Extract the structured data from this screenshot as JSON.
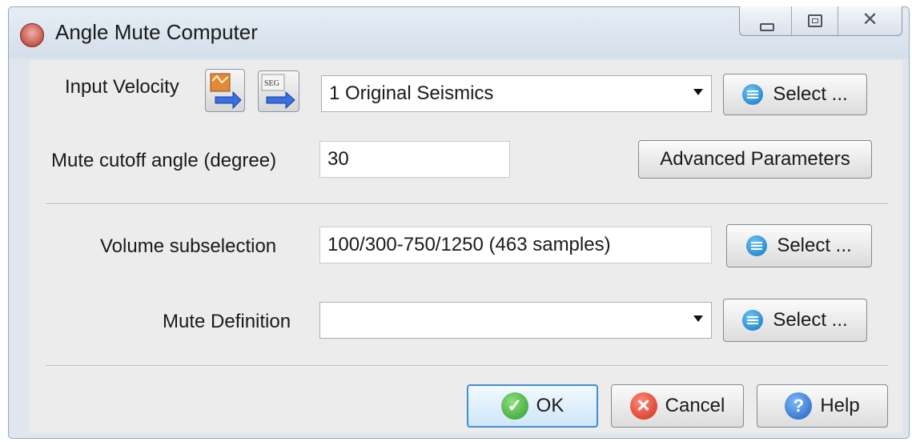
{
  "window": {
    "title": "Angle Mute Computer",
    "controls": {
      "close_glyph": "✕"
    }
  },
  "input_velocity": {
    "label": "Input Velocity",
    "selected": "1 Original Seismics",
    "select_label": "Select ...",
    "seg_icon_text": "SEG"
  },
  "mute_cutoff": {
    "label": "Mute cutoff angle (degree)",
    "value": "30",
    "advanced_label": "Advanced Parameters"
  },
  "volume_subselection": {
    "label": "Volume subselection",
    "value": "100/300-750/1250 (463 samples)",
    "select_label": "Select ..."
  },
  "mute_definition": {
    "label": "Mute Definition",
    "selected": "",
    "select_label": "Select ..."
  },
  "footer": {
    "ok_label": "OK",
    "ok_icon_glyph": "✓",
    "cancel_label": "Cancel",
    "cancel_icon_glyph": "✕",
    "help_label": "Help",
    "help_icon_glyph": "?"
  }
}
